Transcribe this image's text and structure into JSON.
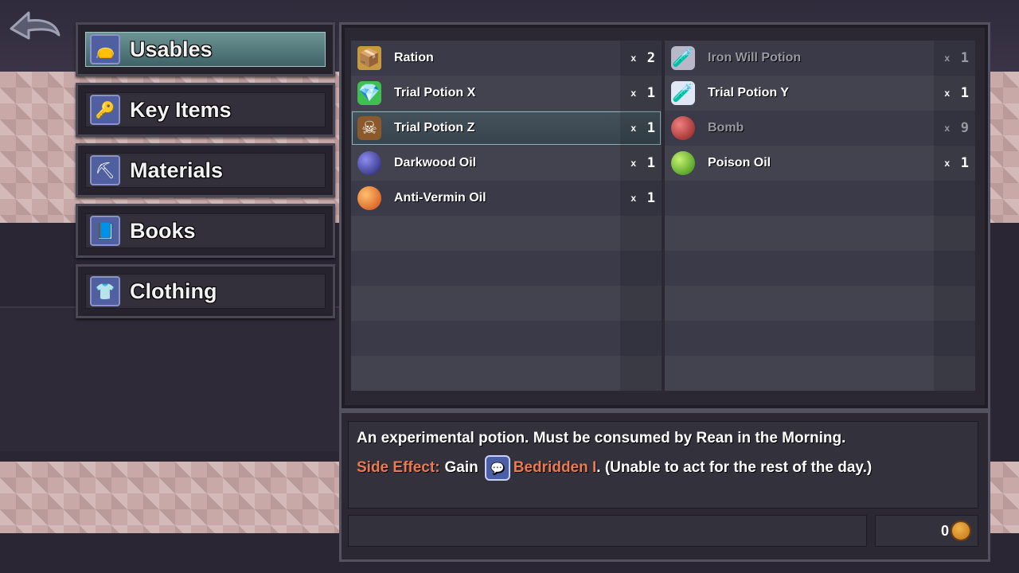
{
  "categories": [
    {
      "label": "Usables",
      "icon": "pouch-icon",
      "active": true
    },
    {
      "label": "Key Items",
      "icon": "key-icon",
      "active": false
    },
    {
      "label": "Materials",
      "icon": "pickaxe-icon",
      "active": false
    },
    {
      "label": "Books",
      "icon": "book-icon",
      "active": false
    },
    {
      "label": "Clothing",
      "icon": "clothing-icon",
      "active": false
    }
  ],
  "items_left": [
    {
      "name": "Ration",
      "qty_prefix": "x",
      "qty": "2",
      "icon": "ration-icon",
      "dim": false,
      "selected": false
    },
    {
      "name": "Trial Potion X",
      "qty_prefix": "x",
      "qty": "1",
      "icon": "green-crystal-icon",
      "dim": false,
      "selected": false
    },
    {
      "name": "Trial Potion Z",
      "qty_prefix": "x",
      "qty": "1",
      "icon": "poison-bottle-icon",
      "dim": false,
      "selected": true
    },
    {
      "name": "Darkwood Oil",
      "qty_prefix": "x",
      "qty": "1",
      "icon": "dark-orb-icon",
      "dim": false,
      "selected": false
    },
    {
      "name": "Anti-Vermin Oil",
      "qty_prefix": "x",
      "qty": "1",
      "icon": "orange-orb-icon",
      "dim": false,
      "selected": false
    }
  ],
  "items_right": [
    {
      "name": "Iron Will Potion",
      "qty_prefix": "x",
      "qty": "1",
      "icon": "potion-bottle-icon",
      "dim": true,
      "selected": false
    },
    {
      "name": "Trial Potion Y",
      "qty_prefix": "x",
      "qty": "1",
      "icon": "potion-bottle-icon",
      "dim": false,
      "selected": false
    },
    {
      "name": "Bomb",
      "qty_prefix": "x",
      "qty": "9",
      "icon": "bomb-icon",
      "dim": true,
      "selected": false
    },
    {
      "name": "Poison Oil",
      "qty_prefix": "x",
      "qty": "1",
      "icon": "green-orb-icon",
      "dim": false,
      "selected": false
    }
  ],
  "description": {
    "line1": "An experimental potion. Must be consumed by Rean in the Morning.",
    "side_effect_label": "Side Effect:",
    "gain_text": "Gain",
    "status_icon": "speech-bubble-icon",
    "status_name": "Bedridden I",
    "tail_text": ". (Unable to act for the rest of the day.)"
  },
  "money": "0",
  "colors": {
    "accent_orange": "#ee7a4f",
    "active_tab": "#6d9494"
  }
}
